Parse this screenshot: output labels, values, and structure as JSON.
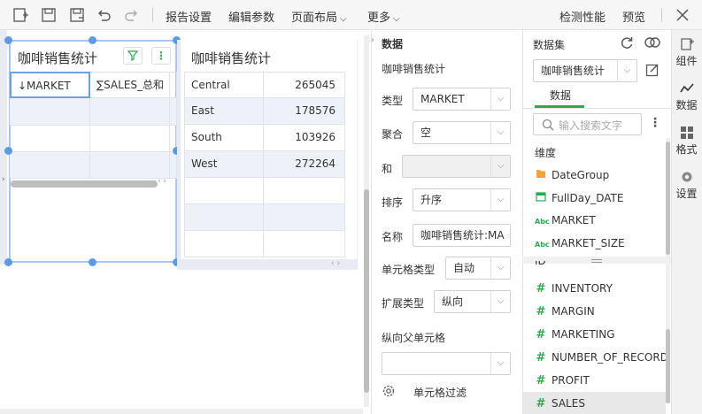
{
  "toolbar": {
    "report_settings": "报告设置",
    "edit_params": "编辑参数",
    "page_layout": "页面布局",
    "more": "更多",
    "check_performance": "检测性能",
    "preview": "预览"
  },
  "table1": {
    "title": "咖啡销售统计",
    "headers": [
      "↓MARKET",
      "∑SALES_总和"
    ]
  },
  "table2": {
    "title": "咖啡销售统计",
    "rows": [
      {
        "market": "Central",
        "sales": "265045"
      },
      {
        "market": "East",
        "sales": "178576"
      },
      {
        "market": "South",
        "sales": "103926"
      },
      {
        "market": "West",
        "sales": "272264"
      }
    ]
  },
  "cell_panel": {
    "section_title": "数据",
    "source": "咖啡销售统计",
    "type_label": "类型",
    "type_value": "MARKET",
    "agg_label": "聚合",
    "agg_value": "空",
    "and_label": "和",
    "and_value": "",
    "sort_label": "排序",
    "sort_value": "升序",
    "name_label": "名称",
    "name_value": "咖啡销售统计:MA",
    "cell_type_label": "单元格类型",
    "cell_type_value": "自动",
    "expand_label": "扩展类型",
    "expand_value": "纵向",
    "parent_label": "纵向父单元格",
    "parent_value": "",
    "filter_label": "单元格过滤"
  },
  "data_panel": {
    "dataset_label": "数据集",
    "dataset_value": "咖啡销售统计",
    "tab_data": "数据",
    "search_placeholder": "输入搜索文字",
    "dimension_label": "维度",
    "dimensions": [
      {
        "name": "DateGroup",
        "icon": "folder-icon"
      },
      {
        "name": "FullDay_DATE",
        "icon": "calendar-icon"
      },
      {
        "name": "MARKET",
        "icon": "abc-icon"
      },
      {
        "name": "MARKET_SIZE",
        "icon": "abc-icon"
      }
    ],
    "partial_measure": "ID",
    "measures": [
      "INVENTORY",
      "MARGIN",
      "MARKETING",
      "NUMBER_OF_RECORDS",
      "PROFIT",
      "SALES"
    ],
    "accent_color": "#2fa84f"
  },
  "rail": {
    "components": "组件",
    "data": "数据",
    "format": "格式",
    "settings": "设置"
  }
}
